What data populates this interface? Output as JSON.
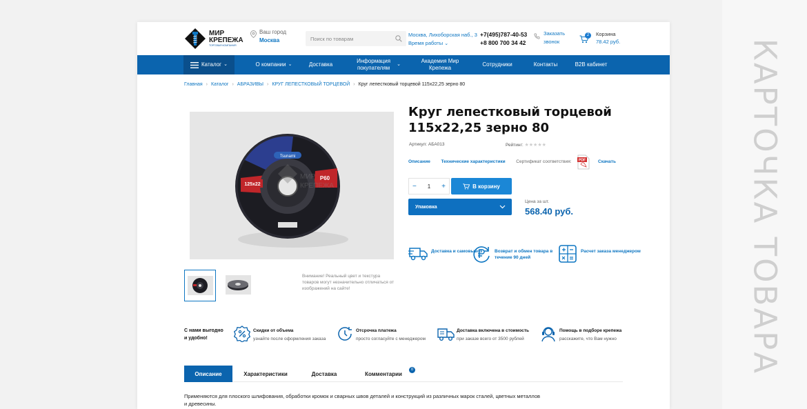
{
  "page_label": "КАРТОЧКА ТОВАРА",
  "header": {
    "logo": {
      "line1": "МИР",
      "line2": "КРЕПЕЖА",
      "tagline": "ТОРГОВАЯ КОМПАНИЯ"
    },
    "city_label": "Ваш город",
    "city_value": "Москва",
    "search_placeholder": "Поиск по товарам",
    "address": "Москва, Лихоборская наб., 3",
    "work_hours": "Время работы",
    "phone1": "+7(495)787-40-53",
    "phone2": "+8 800 700 34 42",
    "callback_line1": "Заказать",
    "callback_line2": "звонок",
    "cart_count": "2",
    "cart_label": "Корзина",
    "cart_sum": "78.42 руб."
  },
  "nav": {
    "items": [
      "Каталог",
      "О компании",
      "Доставка",
      "Информация покупателям",
      "Академия Мир Крепежа",
      "Сотрудники",
      "Контакты",
      "B2B кабинет"
    ]
  },
  "breadcrumbs": [
    "Главная",
    "Каталог",
    "АБРАЗИВЫ",
    "КРУГ ЛЕПЕСТКОВЫЙ ТОРЦЕВОЙ",
    "Круг лепестковый торцевой 115х22,25 зерно 80"
  ],
  "product": {
    "title": "Круг лепестковый торцевой 115х22,25 зерно 80",
    "article_label": "Артикул:",
    "article": "АБА013",
    "rating_label": "Рейтинг:",
    "rating": 0,
    "link_description": "Описание",
    "link_specs": "Технические характеристики",
    "certificate_label": "Сертификат соответствия:",
    "download": "Скачать",
    "quantity": "1",
    "add_to_cart": "В корзину",
    "packaging": "Упаковка",
    "price_label": "Цена за шт.",
    "price": "568.40 руб.",
    "image_notice": "Внимание! Реальный цвет и текстура товаров могут незначительно отличаться от изображений на сайте!",
    "disc_text_size": "125x22",
    "disc_text_grit": "P60",
    "disc_brand": "Tsunami"
  },
  "features": [
    {
      "icon": "truck-icon",
      "text": "Доставка и самовывоз"
    },
    {
      "icon": "ruble-return-icon",
      "text": "Возврат и обмен товара в течение 90 дней"
    },
    {
      "icon": "calculator-icon",
      "text": "Расчет заказа менеджером"
    }
  ],
  "benefits": {
    "title": "С нами выгодно и удобно!",
    "items": [
      {
        "icon": "discount-icon",
        "title": "Скидки от объема",
        "sub": "узнайте после оформления заказа"
      },
      {
        "icon": "clock-icon",
        "title": "Отсрочка платежа",
        "sub": "просто согласуйте с менеджером"
      },
      {
        "icon": "delivery-truck-icon",
        "title": "Доставка включена в стоимость",
        "sub": "при заказе всего от 3500 рублей"
      },
      {
        "icon": "support-icon",
        "title": "Помощь в подборе крепежа",
        "sub": "расскажите, что Вам нужно"
      }
    ]
  },
  "tabs": {
    "items": [
      "Описание",
      "Характеристики",
      "Доставка",
      "Комментарии"
    ],
    "comments_count": "0"
  },
  "description": "Применяются для плоского шлифования, обработки кромок и сварных швов деталей и конструкций из различных марок сталей, цветных металлов и древесины.",
  "colors": {
    "brand_blue": "#0b64ae",
    "accent_blue": "#1b87d6",
    "nav_dark": "#0a4f8c"
  }
}
